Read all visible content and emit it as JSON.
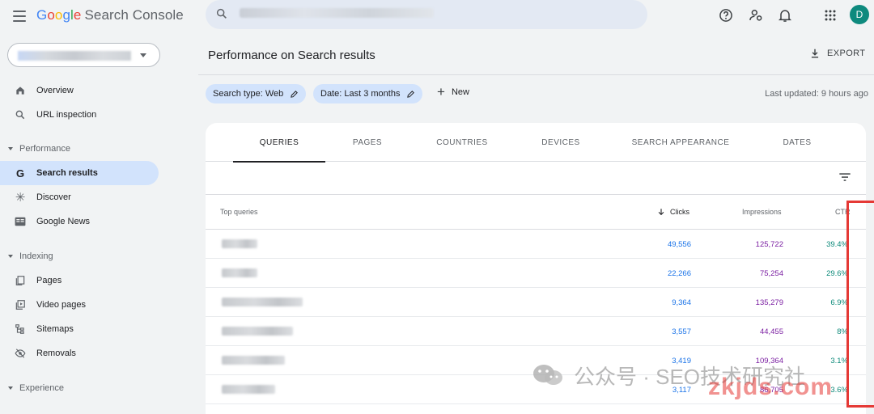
{
  "app": {
    "logo_google": [
      "G",
      "o",
      "o",
      "g",
      "l",
      "e"
    ],
    "logo_product": "Search Console",
    "avatar_letter": "D"
  },
  "topbar_icons": [
    "menu-icon",
    "search-icon",
    "help-icon",
    "manage-users-icon",
    "bell-icon",
    "apps-grid-icon"
  ],
  "sidebar": {
    "items": [
      {
        "label": "Overview",
        "icon": "home-icon"
      },
      {
        "label": "URL inspection",
        "icon": "magnify-icon"
      }
    ],
    "sections": [
      {
        "label": "Performance",
        "items": [
          {
            "label": "Search results",
            "icon": "google-g-icon",
            "active": true
          },
          {
            "label": "Discover",
            "icon": "asterisk-icon"
          },
          {
            "label": "Google News",
            "icon": "news-icon"
          }
        ]
      },
      {
        "label": "Indexing",
        "items": [
          {
            "label": "Pages",
            "icon": "pages-icon"
          },
          {
            "label": "Video pages",
            "icon": "video-icon"
          },
          {
            "label": "Sitemaps",
            "icon": "sitemap-icon"
          },
          {
            "label": "Removals",
            "icon": "removal-icon"
          }
        ]
      },
      {
        "label": "Experience",
        "items": []
      }
    ]
  },
  "main": {
    "title": "Performance on Search results",
    "export_label": "EXPORT",
    "chips": [
      "Search type: Web",
      "Date: Last 3 months"
    ],
    "new_label": "New",
    "last_updated": "Last updated: 9 hours ago"
  },
  "tabs": [
    "QUERIES",
    "PAGES",
    "COUNTRIES",
    "DEVICES",
    "SEARCH APPEARANCE",
    "DATES"
  ],
  "table": {
    "headers": {
      "query": "Top queries",
      "clicks": "Clicks",
      "impressions": "Impressions",
      "ctr": "CTR"
    },
    "rows": [
      {
        "clicks": "49,556",
        "impressions": "125,722",
        "ctr": "39.4%"
      },
      {
        "clicks": "22,266",
        "impressions": "75,254",
        "ctr": "29.6%"
      },
      {
        "clicks": "9,364",
        "impressions": "135,279",
        "ctr": "6.9%"
      },
      {
        "clicks": "3,557",
        "impressions": "44,455",
        "ctr": "8%"
      },
      {
        "clicks": "3,419",
        "impressions": "109,364",
        "ctr": "3.1%"
      },
      {
        "clicks": "3,117",
        "impressions": "86,705",
        "ctr": "3.6%"
      }
    ]
  },
  "watermark": {
    "text": "公众号 · SEO技术研究社",
    "site": "zkjds.com"
  },
  "colors": {
    "clicks": "#1a73e8",
    "impressions": "#7b1fa2",
    "ctr": "#0d8a7a",
    "highlight": "#e53935",
    "active_nav": "#d2e3fc"
  }
}
